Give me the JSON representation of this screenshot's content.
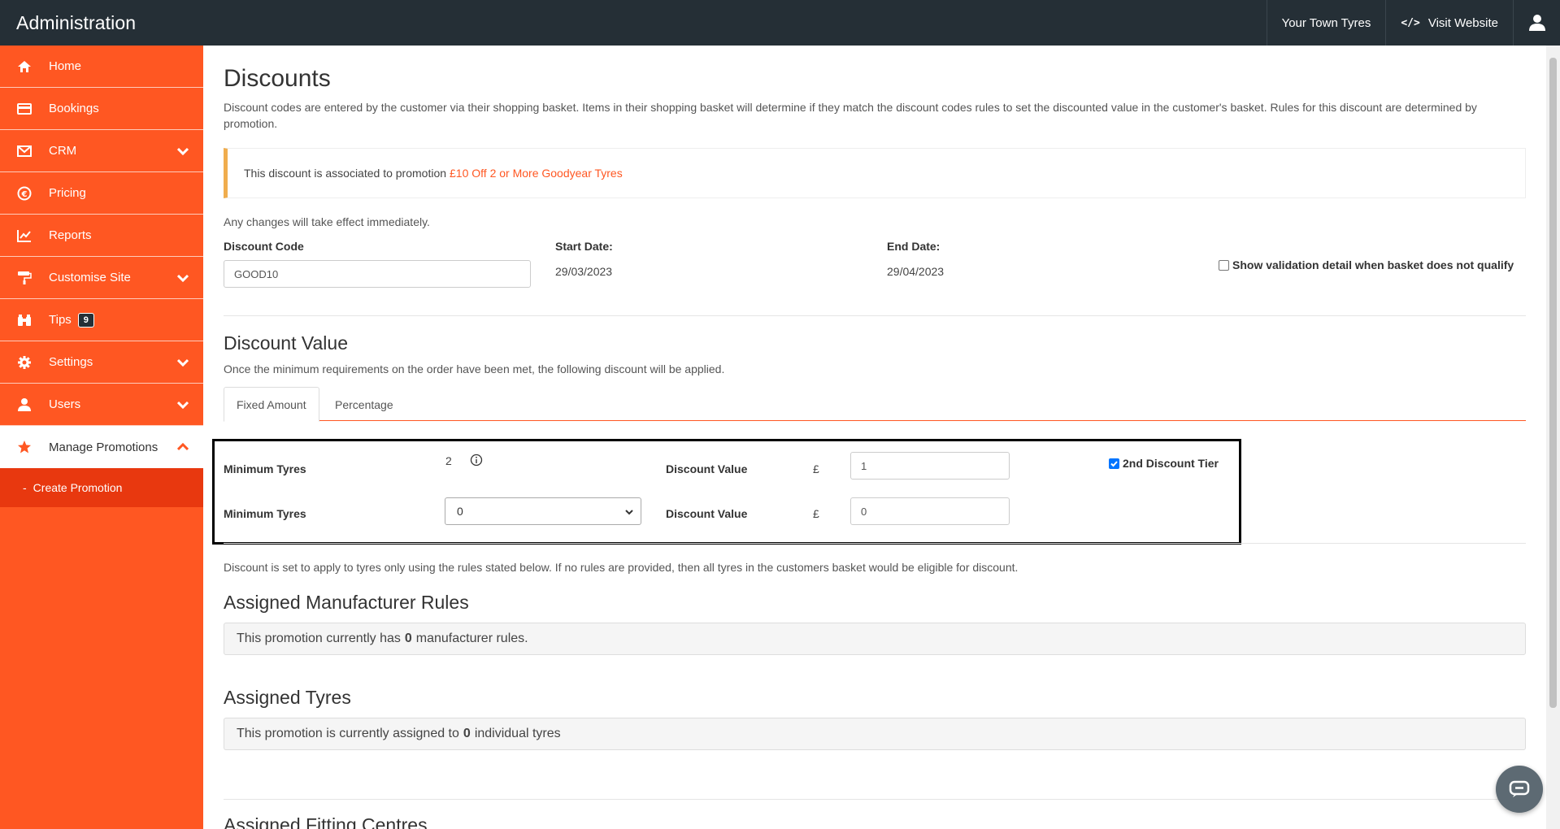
{
  "header": {
    "brand": "Administration",
    "site_name": "Your Town Tyres",
    "visit_label": "Visit Website",
    "icons": [
      "code-icon",
      "user-icon"
    ]
  },
  "sidebar": {
    "items": [
      {
        "label": "Home",
        "icon": "home-icon"
      },
      {
        "label": "Bookings",
        "icon": "card-icon"
      },
      {
        "label": "CRM",
        "icon": "envelope-icon"
      },
      {
        "label": "Pricing",
        "icon": "euro-icon"
      },
      {
        "label": "Reports",
        "icon": "chart-icon"
      },
      {
        "label": "Customise Site",
        "icon": "paint-roller-icon"
      },
      {
        "label": "Tips",
        "icon": "binoculars-icon",
        "badge": "9"
      },
      {
        "label": "Settings",
        "icon": "gear-icon"
      },
      {
        "label": "Users",
        "icon": "user-tie-icon"
      },
      {
        "label": "Manage Promotions",
        "icon": "star-icon"
      }
    ],
    "sub_item": "Create Promotion"
  },
  "page": {
    "title": "Discounts",
    "description": "Discount codes are entered by the customer via their shopping basket. Items in their shopping basket will determine if they match the discount codes rules to set the discounted value in the customer's basket. Rules for this discount are determined by promotion.",
    "alert_text": "This discount is associated to promotion",
    "alert_link": "£10 Off 2 or More Goodyear Tyres",
    "note": "Any changes will take effect immediately.",
    "discount_code_label": "Discount Code",
    "discount_code_value": "GOOD10",
    "start_label": "Start Date:",
    "start_value": "29/03/2023",
    "end_label": "End Date:",
    "end_value": "29/04/2023",
    "validation_checkbox": "Show validation detail when basket does not qualify"
  },
  "discount_value": {
    "title": "Discount Value",
    "subtitle": "Once the minimum requirements on the order have been met, the following discount will be applied.",
    "tabs": [
      "Fixed Amount",
      "Percentage"
    ],
    "tier1": {
      "min_label": "Minimum Tyres",
      "min_value": "2",
      "value_label": "Discount Value",
      "currency": "£",
      "value": "1"
    },
    "tier2_checkbox": "2nd Discount Tier",
    "tier2": {
      "min_label": "Minimum Tyres",
      "min_value": "0",
      "value_label": "Discount Value",
      "currency": "£",
      "value": "0"
    },
    "rules_note": "Discount is set to apply to tyres only using the rules stated below. If no rules are provided, then all tyres in the customers basket would be eligible for discount."
  },
  "manufacturer_rules": {
    "title": "Assigned Manufacturer Rules",
    "pre": "This promotion currently has",
    "count": "0",
    "post": "manufacturer rules."
  },
  "assigned_tyres": {
    "title": "Assigned Tyres",
    "pre": "This promotion is currently assigned to",
    "count": "0",
    "post": "individual tyres"
  },
  "fitting_centres": {
    "title": "Assigned Fitting Centres"
  },
  "colors": {
    "accent": "#ff5722",
    "header": "#252f36"
  }
}
